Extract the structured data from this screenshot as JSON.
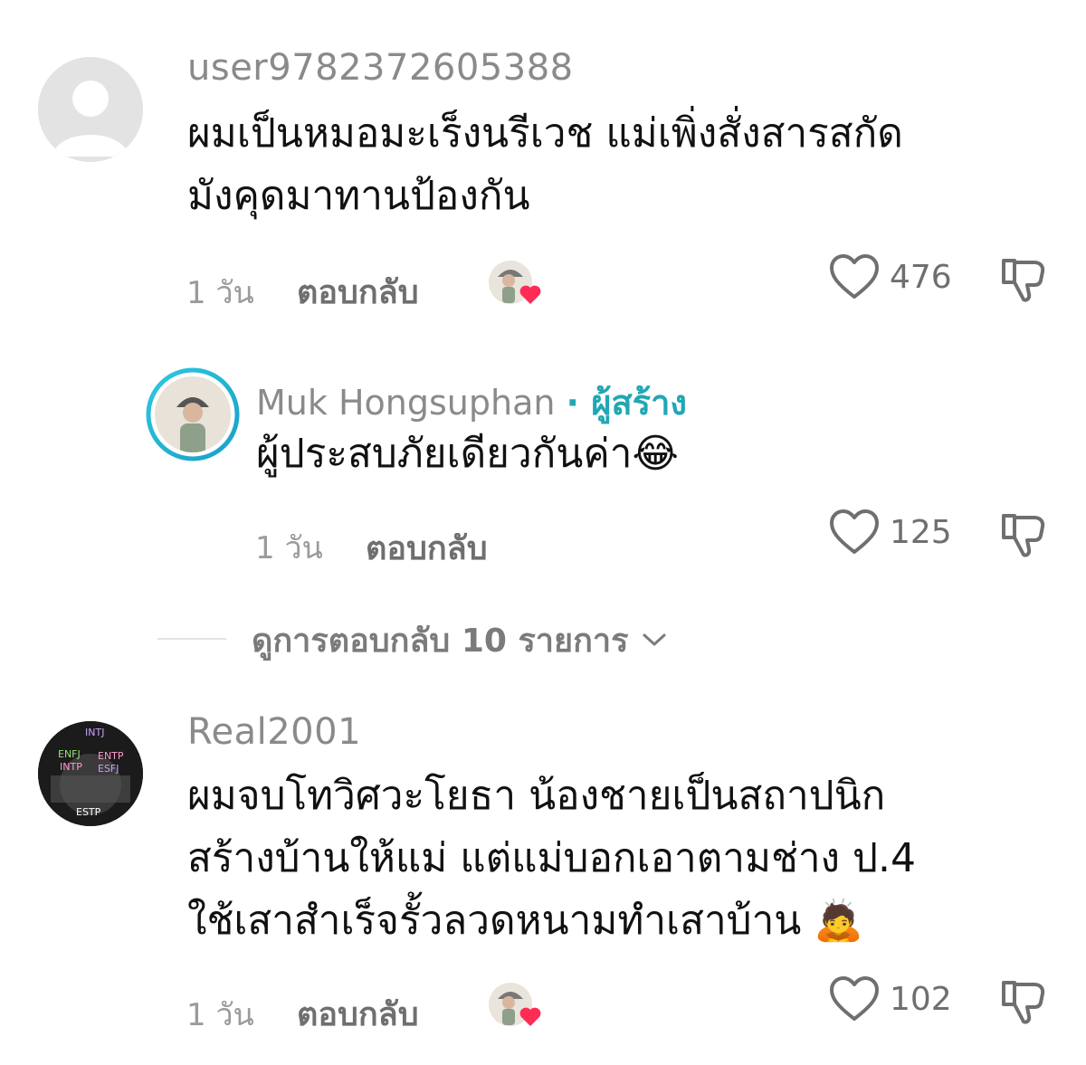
{
  "comments": [
    {
      "username": "user9782372605388",
      "text_lines": [
        "ผมเป็นหมอมะเร็งนรีเวช แม่เพิ่งสั่งสารสกัด",
        "มังคุดมาทานป้องกัน"
      ],
      "time": "1 วัน",
      "reply_label": "ตอบกลับ",
      "like_count": "476",
      "avatar_icon": "default-user-icon"
    },
    {
      "username": "Muk Hongsuphan",
      "creator_label": "· ผู้สร้าง",
      "text_lines": [
        "ผู้ประสบภัยเดียวกันค่า😂"
      ],
      "time": "1 วัน",
      "reply_label": "ตอบกลับ",
      "like_count": "125"
    },
    {
      "username": "Real2001",
      "text_lines": [
        "ผมจบโทวิศวะโยธา น้องชายเป็นสถาปนิก",
        "สร้างบ้านให้แม่ แต่แม่บอกเอาตามช่าง ป.4",
        "ใช้เสาสำเร็จรั้วลวดหนามทำเสาบ้าน 🙇"
      ],
      "time": "1 วัน",
      "reply_label": "ตอบกลับ",
      "like_count": "102",
      "avatar_labels": [
        "INTJ",
        "ENFJ",
        "ENTP",
        "INTP",
        "ESFJ",
        "ESTP"
      ]
    }
  ],
  "view_replies": {
    "label": "ดูการตอบกลับ 10 รายการ",
    "chevron_icon": "chevron-down-icon"
  },
  "colors": {
    "creator_accent": "#20a7b4",
    "like_heart": "#fe2c55",
    "muted_text": "#8a8a8a"
  }
}
